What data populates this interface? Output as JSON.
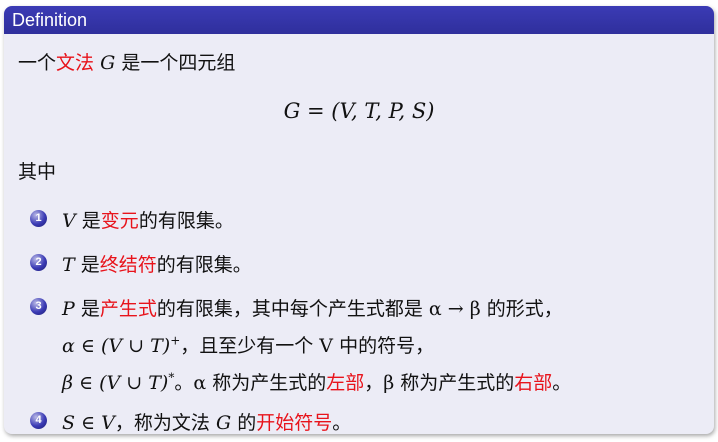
{
  "block": {
    "title": "Definition",
    "intro": {
      "a": "一个",
      "term": "文法",
      "var": "G",
      "b": "是一个四元组"
    },
    "formula": "G = (V, T, P, S)",
    "where": "其中",
    "items": [
      {
        "num": "1",
        "var": "V",
        "pre": "是",
        "term": "变元",
        "post": "的有限集。"
      },
      {
        "num": "2",
        "var": "T",
        "pre": "是",
        "term": "终结符",
        "post": "的有限集。"
      },
      {
        "num": "3",
        "var": "P",
        "pre": "是",
        "term": "产生式",
        "post": "的有限集，其中每个产生式都是 α → β 的形式，",
        "line2_math": "α ∈ (V ∪ T)",
        "line2_sup": "+",
        "line2_text": "，且至少有一个 V 中的符号，",
        "line3_math": "β ∈ (V ∪ T)",
        "line3_sup": "*",
        "line3_a": "。α 称为产生式的",
        "line3_term1": "左部",
        "line3_b": "，β 称为产生式的",
        "line3_term2": "右部",
        "line3_c": "。"
      },
      {
        "num": "4",
        "math": "S ∈ V",
        "a": "，称为文法",
        "var": "G",
        "b": "的",
        "term": "开始符号",
        "c": "。"
      }
    ]
  }
}
